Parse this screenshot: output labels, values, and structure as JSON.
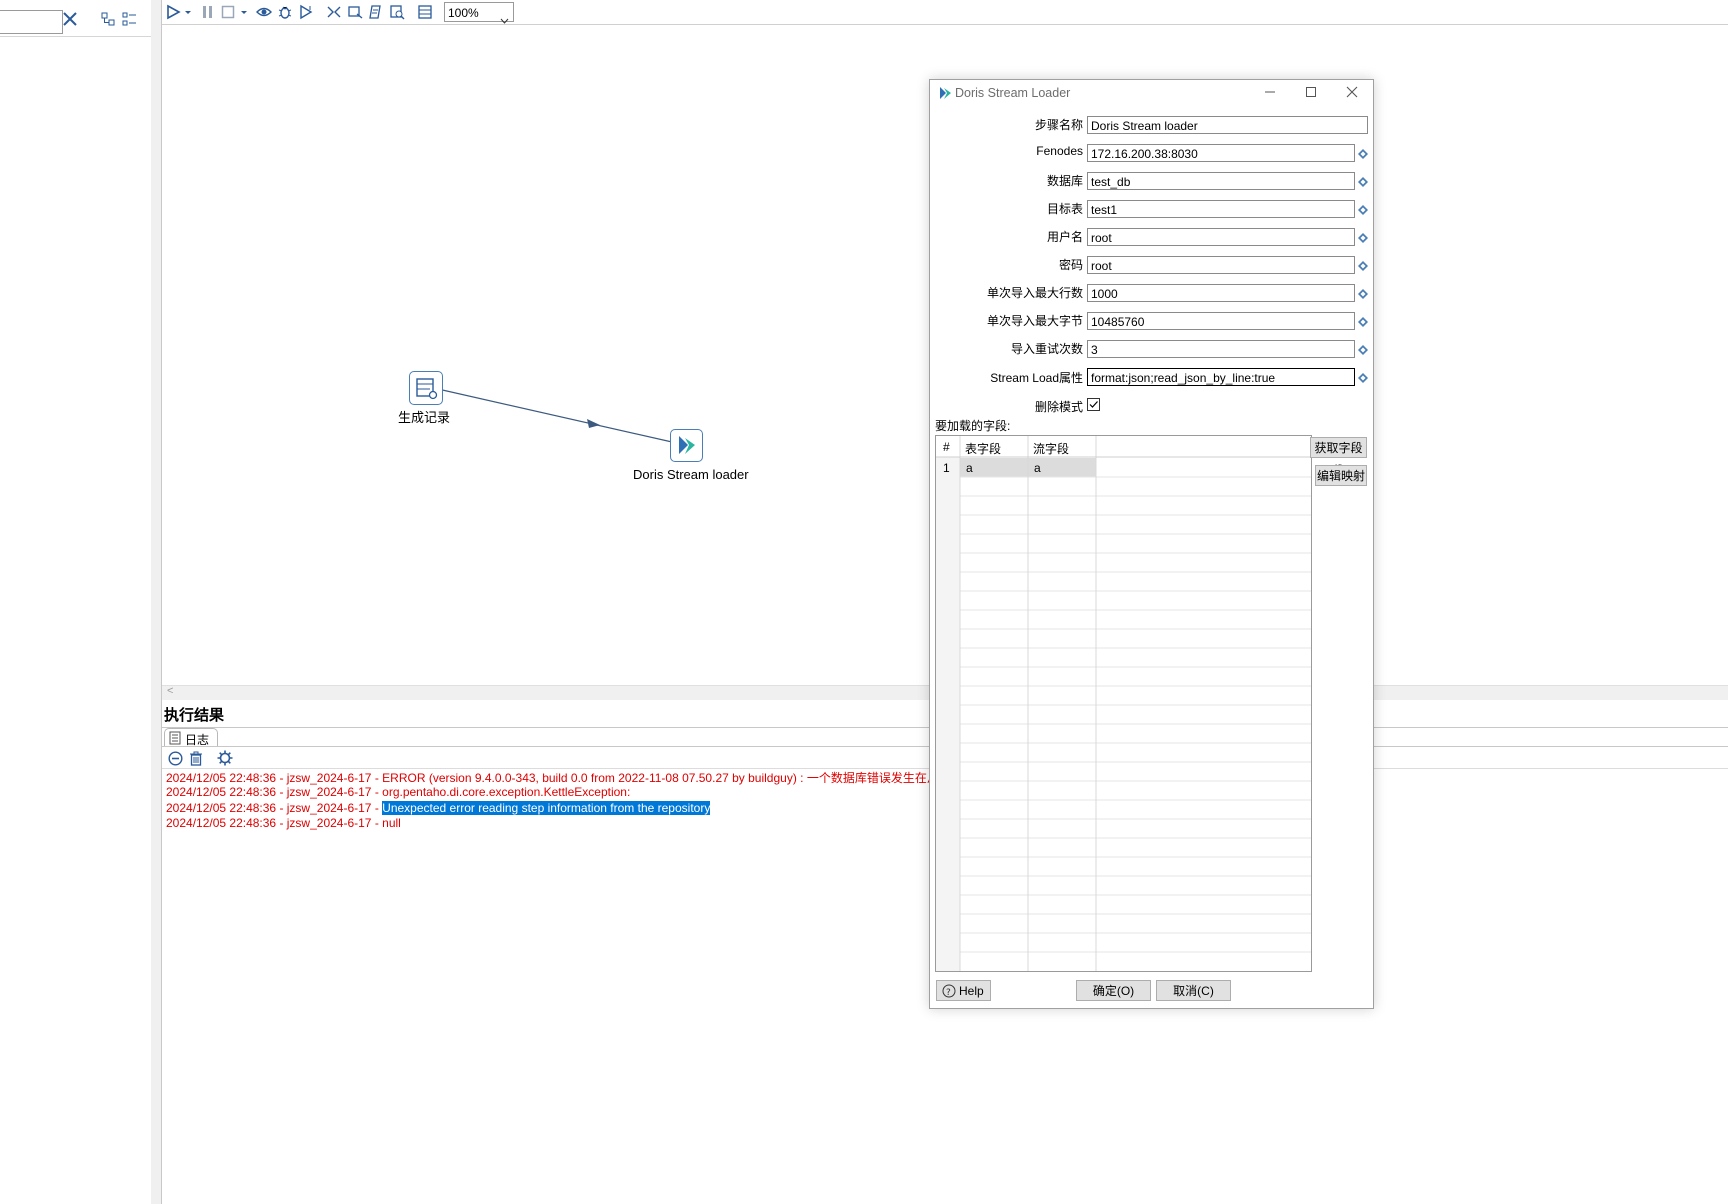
{
  "toolbar": {
    "zoom": "100%"
  },
  "canvas": {
    "step1_label": "生成记录",
    "step2_label": "Doris Stream loader"
  },
  "results": {
    "title": "执行结果",
    "tab_log": "日志",
    "log_lines": [
      "2024/12/05 22:48:36 - jzsw_2024-6-17 - ERROR (version 9.4.0.0-343, build 0.0 from 2022-11-08 07.50.27 by buildguy) : 一个数据库错误发生在从资源",
      "2024/12/05 22:48:36 - jzsw_2024-6-17 - org.pentaho.di.core.exception.KettleException:",
      "2024/12/05 22:48:36 - jzsw_2024-6-17 - ",
      "Unexpected error reading step information from the repository",
      "2024/12/05 22:48:36 - jzsw_2024-6-17 - null"
    ]
  },
  "dialog": {
    "title": "Doris Stream Loader",
    "fields": [
      {
        "label": "步骤名称",
        "value": "Doris Stream loader"
      },
      {
        "label": "Fenodes",
        "value": "172.16.200.38:8030"
      },
      {
        "label": "数据库",
        "value": "test_db"
      },
      {
        "label": "目标表",
        "value": "test1"
      },
      {
        "label": "用户名",
        "value": "root"
      },
      {
        "label": "密码",
        "value": "root"
      },
      {
        "label": "单次导入最大行数",
        "value": "1000"
      },
      {
        "label": "单次导入最大字节",
        "value": "10485760"
      },
      {
        "label": "导入重试次数",
        "value": "3"
      },
      {
        "label": "Stream Load属性",
        "value": "format:json;read_json_by_line:true"
      }
    ],
    "delete_mode_label": "删除模式",
    "delete_mode_checked": true,
    "fields_section_label": "要加载的字段:",
    "grid": {
      "columns": [
        "#",
        "表字段",
        "流字段"
      ],
      "rows": [
        [
          "1",
          "a",
          "a"
        ]
      ]
    },
    "get_fields_button": "获取字段(f)",
    "edit_mapping_button": "编辑映射",
    "help_button": "Help",
    "ok_button": "确定(O)",
    "cancel_button": "取消(C)"
  },
  "colors": {
    "error_text": "#e00000",
    "selection": "#0078d7",
    "doris_teal": "#2bb5a0",
    "doris_blue": "#2f6fb3"
  }
}
